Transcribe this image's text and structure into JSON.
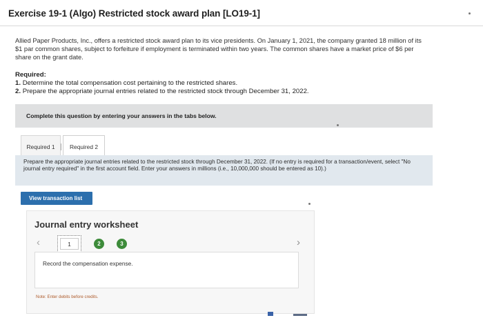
{
  "title": "Exercise 19-1 (Algo) Restricted stock award plan [LO19-1]",
  "intro": "Allied Paper Products, Inc., offers a restricted stock award plan to its vice presidents. On January 1, 2021, the company granted 18 million of its $1 par common shares, subject to forfeiture if employment is terminated within two years. The common shares have a market price of $6 per share on the grant date.",
  "required": {
    "heading": "Required:",
    "items": [
      {
        "num": "1.",
        "text": "Determine the total compensation cost pertaining to the restricted shares."
      },
      {
        "num": "2.",
        "text": "Prepare the appropriate journal entries related to the restricted stock through December 31, 2022."
      }
    ]
  },
  "complete_bar": "Complete this question by entering your answers in the tabs below.",
  "tabs": [
    {
      "label": "Required 1"
    },
    {
      "label": "Required 2"
    }
  ],
  "instructions": "Prepare the appropriate journal entries related to the restricted stock through December 31, 2022. (If no entry is required for a transaction/event, select \"No journal entry required\" in the first account field. Enter your answers in millions (i.e., 10,000,000 should be entered as 10).)",
  "view_button": "View transaction list",
  "journal": {
    "title": "Journal entry worksheet",
    "pages": [
      "1",
      "2",
      "3"
    ],
    "prev_icon": "chevron-left-icon",
    "next_icon": "chevron-right-icon",
    "record_text": "Record the compensation expense.",
    "note": "Note: Enter debits before credits."
  },
  "colors": {
    "button_blue": "#2c6fad",
    "page_green": "#3d8b3a",
    "instruction_bg": "#e1e8ee",
    "note_orange": "#ad5a2a"
  }
}
